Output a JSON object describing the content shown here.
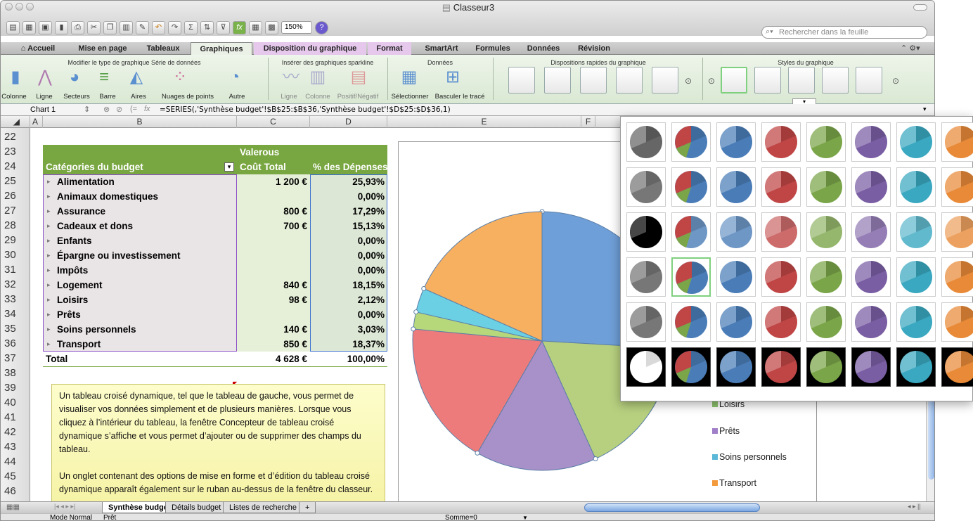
{
  "window": {
    "title": "Classeur3"
  },
  "toolbar": {
    "zoom": "150%",
    "search_placeholder": "Rechercher dans la feuille"
  },
  "ribbon": {
    "tabs": [
      {
        "label": "Accueil"
      },
      {
        "label": "Mise en page"
      },
      {
        "label": "Tableaux"
      },
      {
        "label": "Graphiques"
      },
      {
        "label": "Disposition du graphique"
      },
      {
        "label": "Format"
      },
      {
        "label": "SmartArt"
      },
      {
        "label": "Formules"
      },
      {
        "label": "Données"
      },
      {
        "label": "Révision"
      }
    ],
    "groups": {
      "chart_type": "Modifier le type de graphique Série de données",
      "sparkline": "Insérer des graphiques sparkline",
      "data": "Données",
      "quick_layouts": "Dispositions rapides du graphique",
      "styles": "Styles du graphique"
    },
    "buttons": {
      "colonne": "Colonne",
      "ligne": "Ligne",
      "secteurs": "Secteurs",
      "barre": "Barre",
      "aires": "Aires",
      "nuages": "Nuages de points",
      "autre": "Autre",
      "sp_ligne": "Ligne",
      "sp_colonne": "Colonne",
      "sp_pos": "Positif/Négatif",
      "selectionner": "Sélectionner",
      "basculer": "Basculer le tracé"
    }
  },
  "formula_bar": {
    "name_box": "Chart 1",
    "fx": "fx",
    "formula": "=SERIES(,'Synthèse budget'!$B$25:$B$36,'Synthèse budget'!$D$25:$D$36,1)"
  },
  "columns": [
    "A",
    "B",
    "C",
    "D",
    "E",
    "F"
  ],
  "rows": [
    "22",
    "23",
    "24",
    "25",
    "26",
    "27",
    "28",
    "29",
    "30",
    "31",
    "32",
    "33",
    "34",
    "35",
    "36",
    "37",
    "38",
    "39",
    "40",
    "41",
    "42",
    "43",
    "44",
    "45",
    "46"
  ],
  "pivot": {
    "header_top": "Valerous",
    "header_cat": "Catégories du budget",
    "header_cost": "Coût Total",
    "header_pct": "% des Dépenses",
    "rows": [
      {
        "cat": "Alimentation",
        "cost": "1 200 €",
        "pct": "25,93%"
      },
      {
        "cat": "Animaux domestiques",
        "cost": "",
        "pct": "0,00%"
      },
      {
        "cat": "Assurance",
        "cost": "800 €",
        "pct": "17,29%"
      },
      {
        "cat": "Cadeaux et dons",
        "cost": "700 €",
        "pct": "15,13%"
      },
      {
        "cat": "Enfants",
        "cost": "",
        "pct": "0,00%"
      },
      {
        "cat": "Épargne ou investissement",
        "cost": "",
        "pct": "0,00%"
      },
      {
        "cat": "Impôts",
        "cost": "",
        "pct": "0,00%"
      },
      {
        "cat": "Logement",
        "cost": "840 €",
        "pct": "18,15%"
      },
      {
        "cat": "Loisirs",
        "cost": "98 €",
        "pct": "2,12%"
      },
      {
        "cat": "Prêts",
        "cost": "",
        "pct": "0,00%"
      },
      {
        "cat": "Soins personnels",
        "cost": "140 €",
        "pct": "3,03%"
      },
      {
        "cat": "Transport",
        "cost": "850 €",
        "pct": "18,37%"
      }
    ],
    "total_label": "Total",
    "total_cost": "4 628 €",
    "total_pct": "100,00%"
  },
  "note": {
    "p1": "Un tableau croisé dynamique, tel que le tableau de gauche, vous permet de visualiser vos données simplement et de plusieurs manières. Lorsque vous cliquez à l’intérieur du tableau, la fenêtre Concepteur de tableau croisé dynamique s’affiche et vous permet d’ajouter ou de supprimer des champs du tableau.",
    "p2": "Un onglet contenant des options de mise en forme et d’édition du tableau croisé dynamique apparaît également sur le ruban au-dessus de la fenêtre du classeur."
  },
  "chart_data": {
    "type": "pie",
    "categories": [
      "Alimentation",
      "Animaux domestiques",
      "Assurance",
      "Cadeaux et dons",
      "Enfants",
      "Épargne ou investissement",
      "Impôts",
      "Logement",
      "Loisirs",
      "Prêts",
      "Soins personnels",
      "Transport"
    ],
    "values": [
      25.93,
      0,
      17.29,
      15.13,
      0,
      0,
      0,
      18.15,
      2.12,
      0,
      3.03,
      18.37
    ],
    "colors": [
      "#6f9fd8",
      "#d07a7a",
      "#b7d07f",
      "#a890c8",
      "#6cc8dc",
      "#f7b060",
      "#6f9fd8",
      "#ee7b7b",
      "#b7d87a",
      "#a890c8",
      "#6cd0e4",
      "#f7b060"
    ],
    "legend_visible": [
      "Loisirs",
      "Prêts",
      "Soins personnels",
      "Transport"
    ],
    "legend_colors": [
      "#8fc46f",
      "#a07fc8",
      "#5cb8d8",
      "#f39a3c"
    ]
  },
  "gallery": {
    "styles": [
      [
        "#777",
        "mixed",
        "#4a7db8",
        "#c04646",
        "#7aa548",
        "#7a5ea4",
        "#3aa8c0",
        "#e88a38"
      ]
    ],
    "selected": {
      "row": 3,
      "col": 1
    }
  },
  "sheets": {
    "tabs": [
      "Synthèse budget",
      "Détails budget",
      "Listes de recherche"
    ],
    "add": "+"
  },
  "status": {
    "mode": "Mode Normal",
    "state": "Prêt",
    "sum": "Somme=0"
  }
}
